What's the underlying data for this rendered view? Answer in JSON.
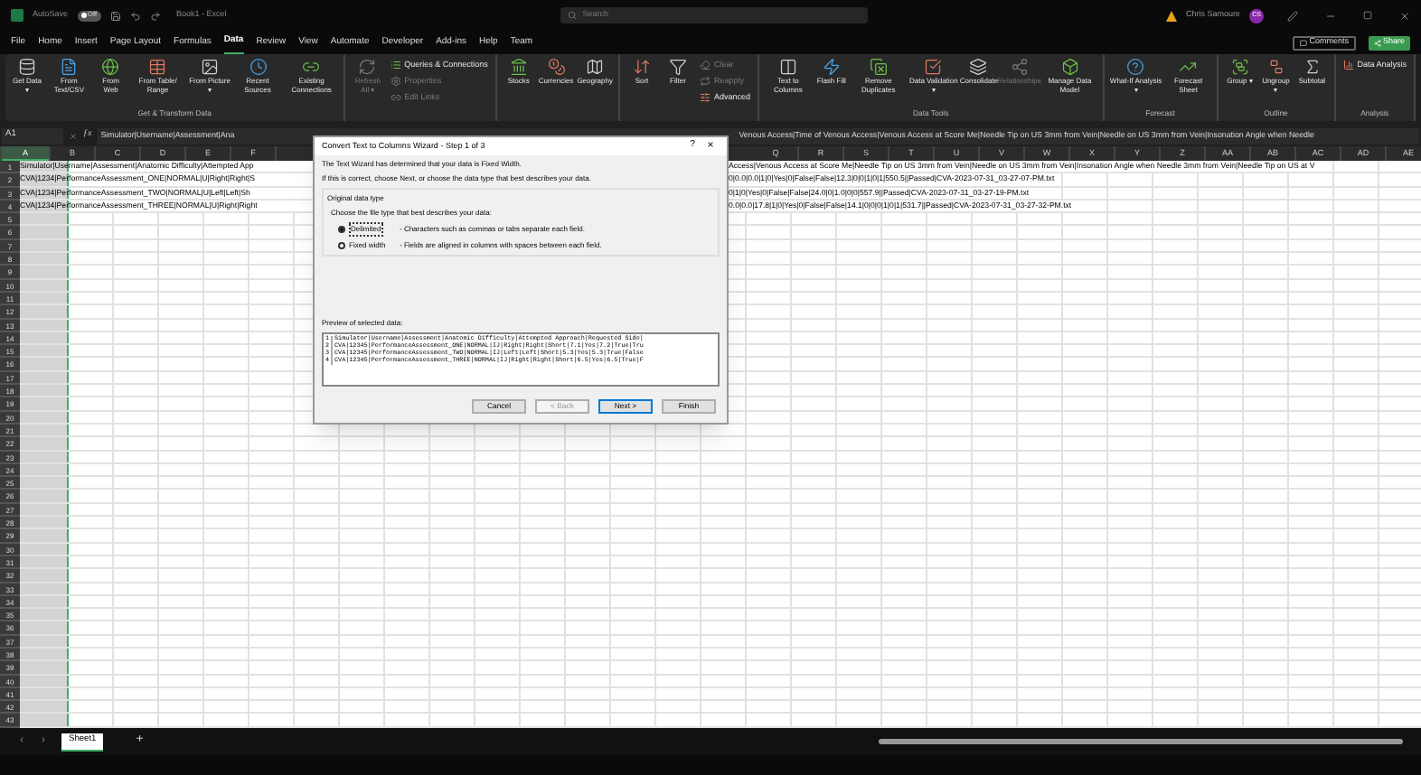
{
  "title_bar": {
    "autosave_label": "AutoSave",
    "autosave_toggle": {
      "label": "Off",
      "on": false
    },
    "document_title": "Book1 - Excel",
    "search_placeholder": "Search",
    "user_name": "Chris Samoure",
    "user_initials": "CS"
  },
  "ribbon_tabs": [
    {
      "label": "File",
      "selected": false
    },
    {
      "label": "Home",
      "selected": false
    },
    {
      "label": "Insert",
      "selected": false
    },
    {
      "label": "Page Layout",
      "selected": false
    },
    {
      "label": "Formulas",
      "selected": false
    },
    {
      "label": "Data",
      "selected": true
    },
    {
      "label": "Review",
      "selected": false
    },
    {
      "label": "View",
      "selected": false
    },
    {
      "label": "Automate",
      "selected": false
    },
    {
      "label": "Developer",
      "selected": false
    },
    {
      "label": "Add-ins",
      "selected": false
    },
    {
      "label": "Help",
      "selected": false
    },
    {
      "label": "Team",
      "selected": false
    }
  ],
  "ribbon_actions": [
    {
      "label": "Comments",
      "kind": "plain"
    },
    {
      "label": "Share",
      "kind": "primary"
    }
  ],
  "ribbon_groups": [
    {
      "label": "Get & Transform Data",
      "buttons": [
        {
          "label": "Get Data ▾",
          "kind": "large",
          "disabled": false
        },
        {
          "label": "From Text/CSV",
          "kind": "large",
          "disabled": false
        },
        {
          "label": "From Web",
          "kind": "large",
          "disabled": false
        },
        {
          "label": "From Table/ Range",
          "kind": "large",
          "disabled": false
        },
        {
          "label": "From Picture ▾",
          "kind": "large",
          "disabled": false
        },
        {
          "label": "Recent Sources",
          "kind": "large",
          "disabled": false
        },
        {
          "label": "Existing Connections",
          "kind": "large",
          "disabled": false
        }
      ]
    },
    {
      "buttons": [
        {
          "label": "Refresh All ▾",
          "kind": "large",
          "disabled": true
        },
        {
          "label": "Queries & Connections",
          "kind": "small",
          "disabled": false
        },
        {
          "label": "Properties",
          "kind": "small",
          "disabled": true
        },
        {
          "label": "Edit Links",
          "kind": "small",
          "disabled": true
        }
      ]
    },
    {
      "buttons": [
        {
          "label": "Stocks",
          "kind": "large",
          "disabled": false
        },
        {
          "label": "Currencies",
          "kind": "large",
          "disabled": false
        },
        {
          "label": "Geography",
          "kind": "large",
          "disabled": false
        }
      ]
    },
    {
      "buttons": [
        {
          "label": "Sort",
          "kind": "large",
          "disabled": false
        },
        {
          "label": "Filter",
          "kind": "large",
          "disabled": false
        },
        {
          "label": "Clear",
          "kind": "small",
          "disabled": true
        },
        {
          "label": "Reapply",
          "kind": "small",
          "disabled": true
        },
        {
          "label": "Advanced",
          "kind": "small",
          "disabled": false
        }
      ]
    },
    {
      "label": "Data Tools",
      "buttons": [
        {
          "label": "Text to Columns",
          "kind": "large",
          "disabled": false
        },
        {
          "label": "Flash Fill",
          "kind": "large",
          "disabled": false
        },
        {
          "label": "Remove Duplicates",
          "kind": "large",
          "disabled": false
        },
        {
          "label": "Data Validation ▾",
          "kind": "large",
          "disabled": false
        },
        {
          "label": "Consolidate",
          "kind": "large",
          "disabled": false
        },
        {
          "label": "Relationships",
          "kind": "large",
          "disabled": true
        },
        {
          "label": "Manage Data Model",
          "kind": "large",
          "disabled": false
        }
      ]
    },
    {
      "label": "Forecast",
      "buttons": [
        {
          "label": "What-If Analysis ▾",
          "kind": "large",
          "disabled": false
        },
        {
          "label": "Forecast Sheet",
          "kind": "large",
          "disabled": false
        }
      ]
    },
    {
      "label": "Outline",
      "buttons": [
        {
          "label": "Group ▾",
          "kind": "large",
          "disabled": false
        },
        {
          "label": "Ungroup ▾",
          "kind": "large",
          "disabled": false
        },
        {
          "label": "Subtotal",
          "kind": "large",
          "disabled": false
        }
      ]
    },
    {
      "label": "Analysis",
      "buttons": [
        {
          "label": "Data Analysis",
          "kind": "small",
          "disabled": false
        }
      ]
    }
  ],
  "formula_bar": {
    "name_box": "A1",
    "function_label": "ƒx",
    "value_left": "Simulator|Username|Assessment|Ana",
    "value_right": "Venous Access|Time of Venous Access|Venous Access at Score Me|Needle Tip on US 3mm from Vein|Needle on US 3mm from Vein|Insonation Angle when Needle"
  },
  "sheet": {
    "columns": [
      {
        "label": "A",
        "selected": true
      },
      {
        "label": "B",
        "selected": false
      },
      {
        "label": "C",
        "selected": false
      },
      {
        "label": "D",
        "selected": false
      },
      {
        "label": "E",
        "selected": false
      },
      {
        "label": "F",
        "selected": false
      },
      {
        "label": "Q",
        "selected": false
      },
      {
        "label": "R",
        "selected": false
      },
      {
        "label": "S",
        "selected": false
      },
      {
        "label": "T",
        "selected": false
      },
      {
        "label": "U",
        "selected": false
      },
      {
        "label": "V",
        "selected": false
      },
      {
        "label": "W",
        "selected": false
      },
      {
        "label": "X",
        "selected": false
      },
      {
        "label": "Y",
        "selected": false
      },
      {
        "label": "Z",
        "selected": false
      },
      {
        "label": "AA",
        "selected": false
      },
      {
        "label": "AB",
        "selected": false
      },
      {
        "label": "AC",
        "selected": false
      },
      {
        "label": "AD",
        "selected": false
      },
      {
        "label": "AE",
        "selected": false
      }
    ],
    "rows": [
      {
        "number": "1",
        "left": "Simulator|Username|Assessment|Anatomic Difficulty|Attempted App",
        "right": "Access|Venous Access at Score Me|Needle Tip on US 3mm from Vein|Needle on US 3mm from Vein|Insonation Angle when Needle 3mm from Vein|Needle Tip on US at V"
      },
      {
        "number": "2",
        "left": "CVA|1234|PerformanceAssessment_ONE|NORMAL|U|Right|Right|S",
        "right": "0|0.0|0.0|1|0|Yes|0|False|False|12.3|0|0|1|0|1|550.5||Passed|CVA-2023-07-31_03-27-07-PM.txt"
      },
      {
        "number": "3",
        "left": "CVA|1234|PerformanceAssessment_TWO|NORMAL|U|Left|Left|Sh",
        "right": "0|1|0|Yes|0|False|False|24.0|0|1.0|0|0|557.9||Passed|CVA-2023-07-31_03-27-19-PM.txt"
      },
      {
        "number": "4",
        "left": "CVA|1234|PerformanceAssessment_THREE|NORMAL|U|Right|Right",
        "right": "0.0|0.0|17.8|1|0|Yes|0|False|False|14.1|0|0|0|1|0|1|531.7||Passed|CVA-2023-07-31_03-27-32-PM.txt"
      },
      {
        "number": "5"
      },
      {
        "number": "6"
      },
      {
        "number": "7"
      },
      {
        "number": "8"
      },
      {
        "number": "9"
      },
      {
        "number": "10"
      },
      {
        "number": "11"
      },
      {
        "number": "12"
      },
      {
        "number": "13"
      },
      {
        "number": "14"
      },
      {
        "number": "15"
      },
      {
        "number": "16"
      },
      {
        "number": "17"
      },
      {
        "number": "18"
      },
      {
        "number": "19"
      },
      {
        "number": "20"
      },
      {
        "number": "21"
      },
      {
        "number": "22"
      },
      {
        "number": "23"
      },
      {
        "number": "24"
      },
      {
        "number": "25"
      },
      {
        "number": "26"
      },
      {
        "number": "27"
      },
      {
        "number": "28"
      },
      {
        "number": "29"
      },
      {
        "number": "30"
      },
      {
        "number": "31"
      },
      {
        "number": "32"
      },
      {
        "number": "33"
      },
      {
        "number": "34"
      },
      {
        "number": "35"
      },
      {
        "number": "36"
      },
      {
        "number": "37"
      },
      {
        "number": "38"
      },
      {
        "number": "39"
      },
      {
        "number": "40"
      },
      {
        "number": "41"
      },
      {
        "number": "42"
      },
      {
        "number": "43"
      }
    ]
  },
  "dialog": {
    "title": "Convert Text to Columns Wizard - Step 1 of 3",
    "help": "?",
    "close": "×",
    "intro": "The Text Wizard has determined that your data is Fixed Width.",
    "instruction": "If this is correct, choose Next, or choose the data type that best describes your data.",
    "group_label": "Original data type",
    "group_prompt": "Choose the file type that best describes your data:",
    "options": [
      {
        "label": "Delimited",
        "description": "- Characters such as commas or tabs separate each field.",
        "selected": true
      },
      {
        "label": "Fixed width",
        "description": "- Fields are aligned in columns with spaces between each field.",
        "selected": false
      }
    ],
    "preview_label": "Preview of selected data:",
    "preview_lines": [
      {
        "number": "1",
        "text": "Simulator|Username|Assessment|Anatomic Difficulty|Attempted Approach|Requested Side|"
      },
      {
        "number": "2",
        "text": "CVA|12345|PerformanceAssessment_ONE|NORMAL|IJ|Right|Right|Short|7.1|Yes|7.2|True|Tru"
      },
      {
        "number": "3",
        "text": "CVA|12345|PerformanceAssessment_TWO|NORMAL|IJ|Left|Left|Short|5.3|Yes|5.3|True|False"
      },
      {
        "number": "4",
        "text": "CVA|12345|PerformanceAssessment_THREE|NORMAL|IJ|Right|Right|Short|6.5|Yes|6.5|True|F"
      }
    ],
    "buttons": [
      {
        "label": "Cancel",
        "disabled": false,
        "default": false
      },
      {
        "label": "< Back",
        "disabled": true,
        "default": false
      },
      {
        "label": "Next >",
        "disabled": false,
        "default": true
      },
      {
        "label": "Finish",
        "disabled": false,
        "default": false
      }
    ]
  },
  "sheet_nav": [
    "‹",
    "›"
  ],
  "sheet_tabs": [
    {
      "label": "Sheet1",
      "selected": true
    }
  ],
  "add_sheet": "+"
}
